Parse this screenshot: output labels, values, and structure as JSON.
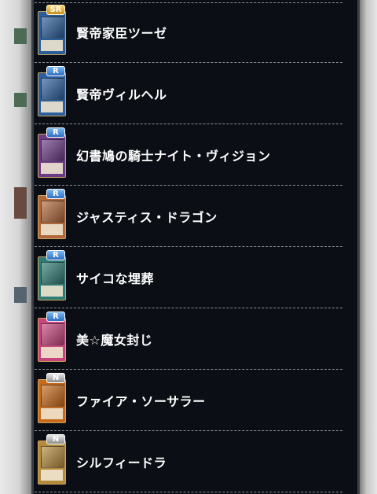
{
  "cards": [
    {
      "name": "賢帝家臣ツーゼ",
      "rarity": "SR",
      "color": "#2a5d9a"
    },
    {
      "name": "賢帝ヴィルヘル",
      "rarity": "R",
      "color": "#2c5f9e"
    },
    {
      "name": "幻書鳩の騎士ナイト・ヴィジョン",
      "rarity": "R",
      "color": "#6a3b86"
    },
    {
      "name": "ジャスティス・ドラゴン",
      "rarity": "R",
      "color": "#b0683a"
    },
    {
      "name": "サイコな埋葬",
      "rarity": "R",
      "color": "#2f7c77"
    },
    {
      "name": "美☆魔女封じ",
      "rarity": "R",
      "color": "#c6457d"
    },
    {
      "name": "ファイア・ソーサラー",
      "rarity": "N",
      "color": "#c86a1c"
    },
    {
      "name": "シルフィードラ",
      "rarity": "N",
      "color": "#b48a3c"
    }
  ]
}
